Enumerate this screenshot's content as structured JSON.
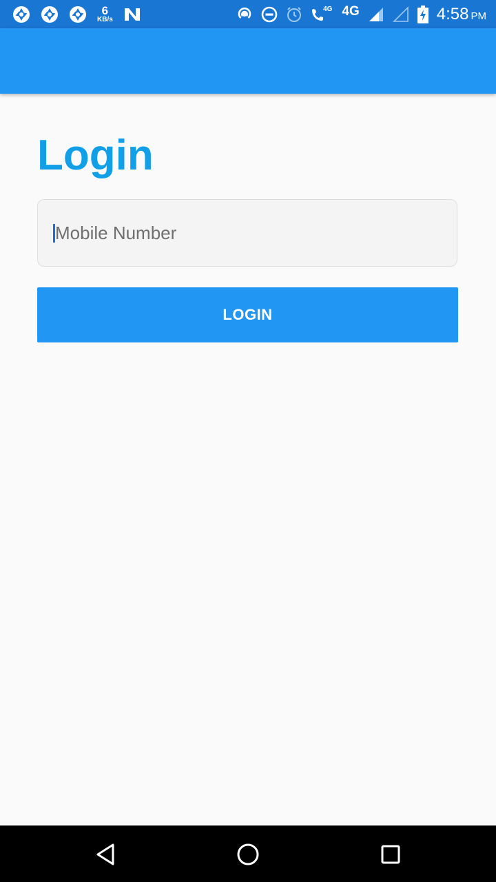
{
  "status_bar": {
    "icons_left": [
      "shutter-icon",
      "shutter-icon",
      "shutter-icon",
      "n-icon"
    ],
    "speed_value": "6",
    "speed_unit": "KB/s",
    "icons_right": [
      "hotspot-icon",
      "do-not-disturb-icon",
      "alarm-icon",
      "volte-call-icon",
      "signal-icon",
      "signal-empty-icon",
      "battery-charging-icon"
    ],
    "volte_label": "4G",
    "network_type": "4G",
    "time": "4:58",
    "ampm": "PM"
  },
  "app_bar": {
    "color": "#2196f3"
  },
  "main": {
    "title": "Login",
    "title_color": "#11a0e8",
    "mobile_input": {
      "value": "",
      "placeholder": "Mobile Number"
    },
    "login_button_label": "LOGIN",
    "button_color": "#2196f3"
  },
  "nav_bar": {
    "buttons": [
      "back-icon",
      "home-icon",
      "recents-icon"
    ]
  }
}
